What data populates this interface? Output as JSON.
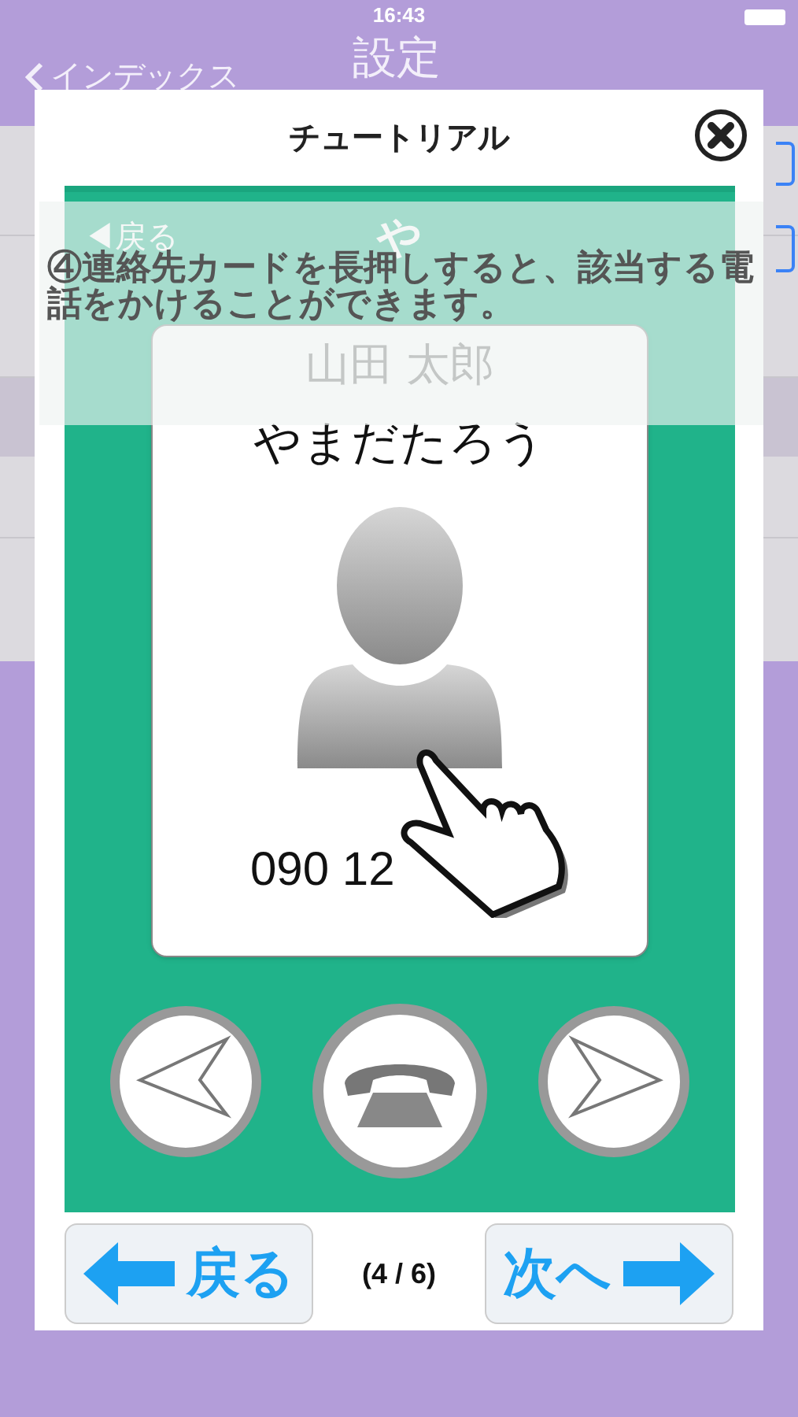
{
  "status_bar": {
    "time": "16:43"
  },
  "nav_bar": {
    "back": "インデックス",
    "title": "設定"
  },
  "dialog": {
    "title": "チュートリアル",
    "screenshot": {
      "nav_back": "◀戻る",
      "nav_title": "や",
      "card": {
        "name": "山田 太郎",
        "reading": "やまだたろう",
        "phone": "090 12"
      }
    },
    "caption": "④連絡先カードを長押しすると、該当する電話をかけることができます。",
    "back_button": "戻る",
    "page_indicator": "(4 / 6)",
    "next_button": "次へ"
  }
}
